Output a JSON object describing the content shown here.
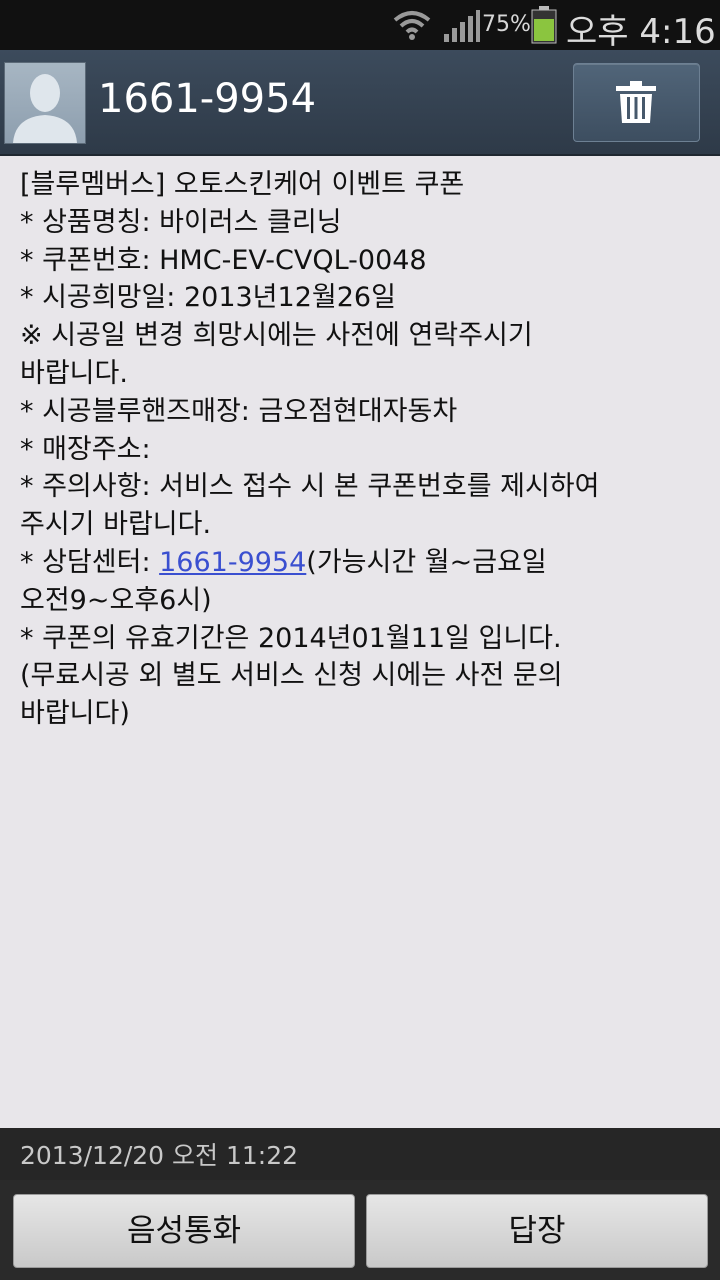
{
  "status_bar": {
    "battery_percent": "75%",
    "time": "오후 4:16",
    "icons": [
      "wifi-icon",
      "signal-icon",
      "battery-icon"
    ],
    "battery_color": "#8bc53f"
  },
  "header": {
    "sender": "1661-9954",
    "avatar_icon": "contact-avatar-icon",
    "delete_icon": "trash-icon"
  },
  "message": {
    "lines": [
      "[블루멤버스] 오토스킨케어 이벤트 쿠폰",
      "* 상품명칭: 바이러스 클리닝",
      "* 쿠폰번호: HMC-EV-CVQL-0048",
      "* 시공희망일: 2013년12월26일",
      "※ 시공일 변경 희망시에는 사전에 연락주시기",
      "바랍니다.",
      "* 시공블루핸즈매장: 금오점현대자동차",
      "* 매장주소:",
      "* 주의사항: 서비스 접수 시 본 쿠폰번호를 제시하여",
      "주시기 바랍니다."
    ],
    "consult_prefix": "* 상담센터: ",
    "consult_link": "1661-9954",
    "consult_suffix": "(가능시간 월~금요일",
    "lines_after": [
      "오전9~오후6시)",
      "* 쿠폰의 유효기간은 2014년01월11일 입니다.",
      "(무료시공 외 별도 서비스 신청 시에는 사전 문의",
      "바랍니다)"
    ],
    "link_color": "#3a4fd0"
  },
  "timestamp": "2013/12/20 오전 11:22",
  "buttons": {
    "call_label": "음성통화",
    "reply_label": "답장"
  }
}
